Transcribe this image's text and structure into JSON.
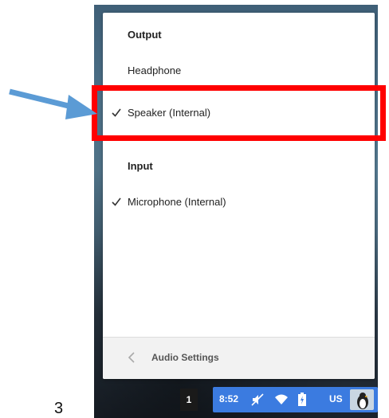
{
  "step_number": "3",
  "audio_menu": {
    "output_header": "Output",
    "output_devices": [
      {
        "label": "Headphone",
        "selected": false
      },
      {
        "label": "Speaker (Internal)",
        "selected": true
      }
    ],
    "input_header": "Input",
    "input_devices": [
      {
        "label": "Microphone (Internal)",
        "selected": true
      }
    ],
    "footer_title": "Audio Settings"
  },
  "shelf": {
    "badge": "1",
    "time": "8:52",
    "locale": "US",
    "icons": [
      "mute-icon",
      "wifi-icon",
      "battery-icon",
      "avatar"
    ]
  },
  "annotation": {
    "arrow_color": "#5b9bd5",
    "highlight_color": "#ff0000"
  }
}
